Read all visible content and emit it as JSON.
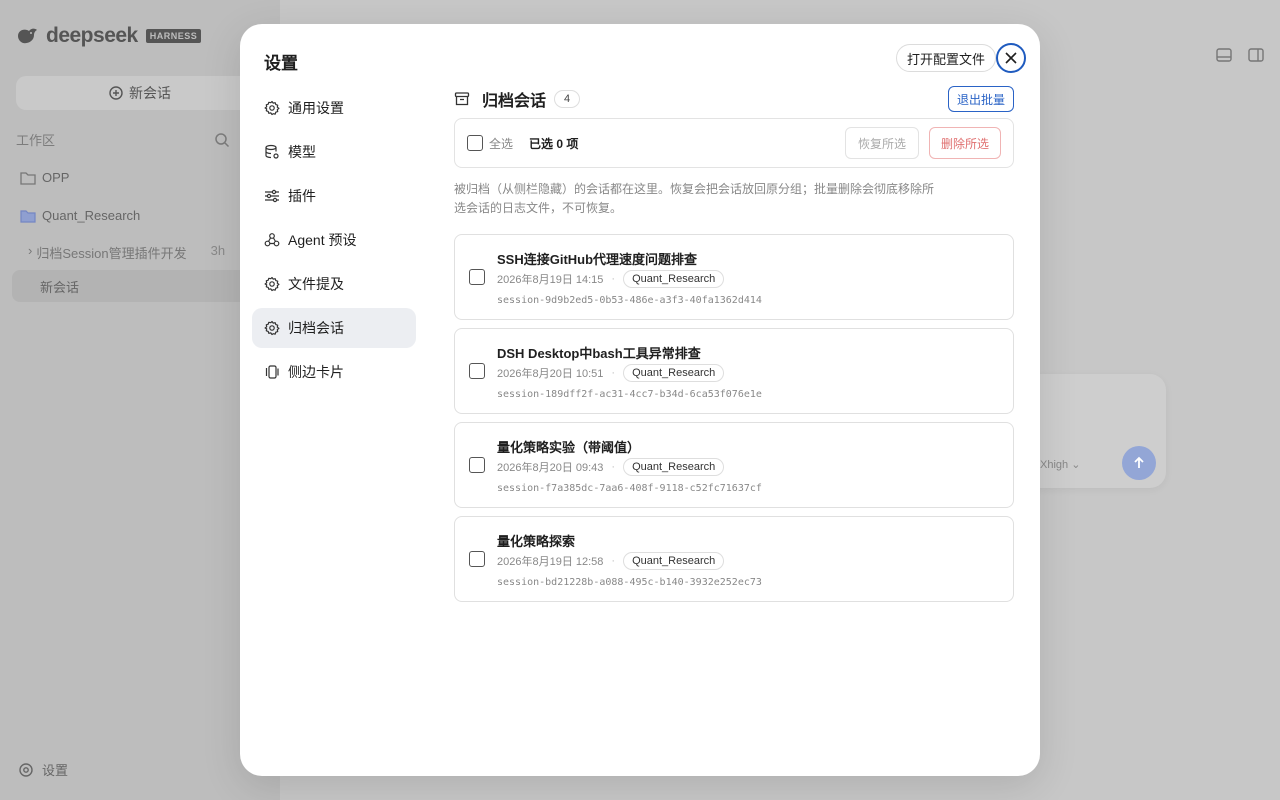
{
  "background": {
    "logo": "deepseek",
    "logo_badge": "HARNESS",
    "new_chat": "新会话",
    "workspace_label": "工作区",
    "workspaces": [
      "OPP",
      "Quant_Research"
    ],
    "sessions": [
      {
        "label": "归档Session管理插件开发",
        "suffix": "3h"
      },
      {
        "label": "新会话"
      }
    ],
    "settings_label": "设置",
    "model_label": "Xhigh"
  },
  "modal": {
    "title": "设置",
    "open_config": "打开配置文件",
    "nav": [
      {
        "label": "通用设置",
        "icon": "gear-icon"
      },
      {
        "label": "模型",
        "icon": "database-icon"
      },
      {
        "label": "插件",
        "icon": "sliders-icon"
      },
      {
        "label": "Agent 预设",
        "icon": "agent-icon"
      },
      {
        "label": "文件提及",
        "icon": "gear-icon"
      },
      {
        "label": "归档会话",
        "icon": "gear-icon",
        "active": true
      },
      {
        "label": "侧边卡片",
        "icon": "cards-icon"
      }
    ],
    "section": {
      "title": "归档会话",
      "count": "4",
      "exit_batch": "退出批量",
      "select_all": "全选",
      "selected_count": "已选 0 项",
      "restore": "恢复所选",
      "delete": "删除所选",
      "description": "被归档（从侧栏隐藏）的会话都在这里。恢复会把会话放回原分组；批量删除会彻底移除所选会话的日志文件，不可恢复。"
    },
    "sessions": [
      {
        "title": "SSH连接GitHub代理速度问题排查",
        "date": "2026年8月19日 14:15",
        "workspace": "Quant_Research",
        "id": "session-9d9b2ed5-0b53-486e-a3f3-40fa1362d414"
      },
      {
        "title": "DSH Desktop中bash工具异常排查",
        "date": "2026年8月20日 10:51",
        "workspace": "Quant_Research",
        "id": "session-189dff2f-ac31-4cc7-b34d-6ca53f076e1e"
      },
      {
        "title": "量化策略实验（带阈值）",
        "date": "2026年8月20日 09:43",
        "workspace": "Quant_Research",
        "id": "session-f7a385dc-7aa6-408f-9118-c52fc71637cf"
      },
      {
        "title": "量化策略探索",
        "date": "2026年8月19日 12:58",
        "workspace": "Quant_Research",
        "id": "session-bd21228b-a088-495c-b140-3932e252ec73"
      }
    ]
  },
  "colors": {
    "accent": "#2a63c6",
    "danger": "#e07070",
    "active_nav": "#eceef2",
    "overlay": "#c4c4c4"
  }
}
